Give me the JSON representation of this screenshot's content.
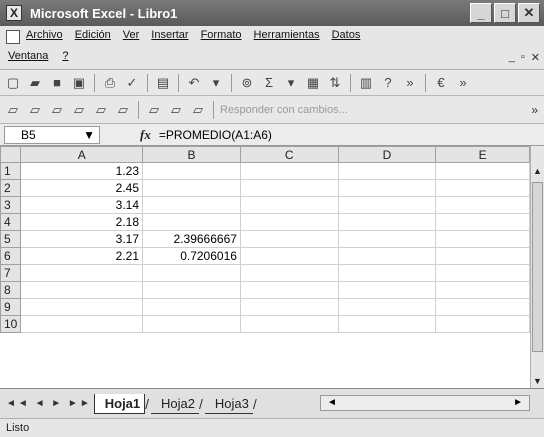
{
  "window": {
    "title": "Microsoft Excel - Libro1",
    "app_icon": "X"
  },
  "menus": {
    "row1": [
      "Archivo",
      "Edición",
      "Ver",
      "Insertar",
      "Formato",
      "Herramientas",
      "Datos"
    ],
    "row2": [
      "Ventana",
      "?"
    ]
  },
  "toolbar2": {
    "respond_label": "Responder con cambios..."
  },
  "formulabar": {
    "cell_ref": "B5",
    "formula": "=PROMEDIO(A1:A6)"
  },
  "grid": {
    "columns": [
      "A",
      "B",
      "C",
      "D",
      "E"
    ],
    "rows": [
      {
        "num": "1",
        "a": "1.23",
        "b": ""
      },
      {
        "num": "2",
        "a": "2.45",
        "b": ""
      },
      {
        "num": "3",
        "a": "3.14",
        "b": ""
      },
      {
        "num": "4",
        "a": "2.18",
        "b": ""
      },
      {
        "num": "5",
        "a": "3.17",
        "b": "2.39666667"
      },
      {
        "num": "6",
        "a": "2.21",
        "b": "0.7206016"
      },
      {
        "num": "7",
        "a": "",
        "b": ""
      },
      {
        "num": "8",
        "a": "",
        "b": ""
      },
      {
        "num": "9",
        "a": "",
        "b": ""
      },
      {
        "num": "10",
        "a": "",
        "b": ""
      }
    ]
  },
  "sheets": {
    "tab1": "Hoja1",
    "tab2": "Hoja2",
    "tab3": "Hoja3"
  },
  "status": {
    "text": "Listo"
  }
}
